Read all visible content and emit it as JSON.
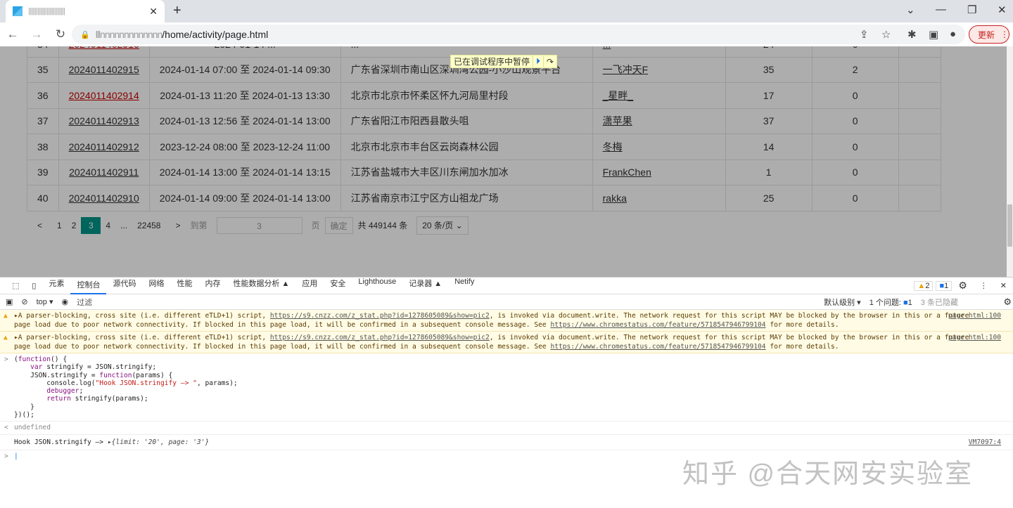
{
  "browser": {
    "tab_title": "||||||||||||||||||||||||||||",
    "url_host": "lllnnnnnnnnnnnnn",
    "url_path": "/home/activity/page.html",
    "update_label": "更新"
  },
  "paused_banner": "已在调试程序中暂停",
  "rows": [
    {
      "n": "35",
      "id": "2024011402915",
      "time": "2024-01-14 07:00 至 2024-01-14 09:30",
      "loc": "广东省深圳市南山区深圳湾公园-小沙山观景平台",
      "user": "一飞冲天F",
      "a": "35",
      "b": "2",
      "red": false
    },
    {
      "n": "36",
      "id": "2024011402914",
      "time": "2024-01-13 11:20 至 2024-01-13 13:30",
      "loc": "北京市北京市怀柔区怀九河局里村段",
      "user": "_星畔_",
      "a": "17",
      "b": "0",
      "red": true
    },
    {
      "n": "37",
      "id": "2024011402913",
      "time": "2024-01-13 12:56 至 2024-01-14 13:00",
      "loc": "广东省阳江市阳西县散头咀",
      "user": "潇苹果",
      "a": "37",
      "b": "0",
      "red": false
    },
    {
      "n": "38",
      "id": "2024011402912",
      "time": "2023-12-24 08:00 至 2023-12-24 11:00",
      "loc": "北京市北京市丰台区云岗森林公园",
      "user": "冬梅",
      "a": "14",
      "b": "0",
      "red": false
    },
    {
      "n": "39",
      "id": "2024011402911",
      "time": "2024-01-14 13:00 至 2024-01-14 13:15",
      "loc": "江苏省盐城市大丰区川东闸加水加冰",
      "user": "FrankChen",
      "a": "1",
      "b": "0",
      "red": false
    },
    {
      "n": "40",
      "id": "2024011402910",
      "time": "2024-01-14 09:00 至 2024-01-14 13:00",
      "loc": "江苏省南京市江宁区方山祖龙广场",
      "user": "rakka",
      "a": "25",
      "b": "0",
      "red": false
    }
  ],
  "pager": {
    "pages": [
      "1",
      "2",
      "3",
      "4",
      "...",
      "22458"
    ],
    "goto": "到第",
    "input": "3",
    "page_unit": "页",
    "confirm": "确定",
    "total": "共 449144 条",
    "size": "20 条/页"
  },
  "devtools": {
    "tabs": [
      "元素",
      "控制台",
      "源代码",
      "网络",
      "性能",
      "内存",
      "性能数据分析 ▲",
      "应用",
      "安全",
      "Lighthouse",
      "记录器 ▲",
      "Netify"
    ],
    "warn_count": "2",
    "info_count": "1",
    "context": "top ▾",
    "filter_placeholder": "过滤",
    "level": "默认级别 ▾",
    "issues": "1 个问题:",
    "issues_count": "1",
    "hidden": "3 条已隐藏",
    "warn_pre": "▸A parser-blocking, cross site (i.e. different eTLD+1) script, ",
    "warn_link": "https://s9.cnzz.com/z_stat.php?id=1278605089&show=pic2",
    "warn_mid": ", is invoked via document.write. The network request for this script MAY be blocked by the browser in this or a future",
    "warn_line2": "page load due to poor network connectivity. If blocked in this page load, it will be confirmed in a subsequent console message. See ",
    "warn_link2": "https://www.chromestatus.com/feature/5718547946799104",
    "warn_end": " for more details.",
    "warn_src": "page.html:100",
    "undefined": "undefined",
    "log_text": "Hook JSON.stringify —> ",
    "log_obj": "▸{limit: '20', page: '3'}",
    "log_src": "VM7097:4"
  },
  "watermark": "知乎 @合天网安实验室"
}
